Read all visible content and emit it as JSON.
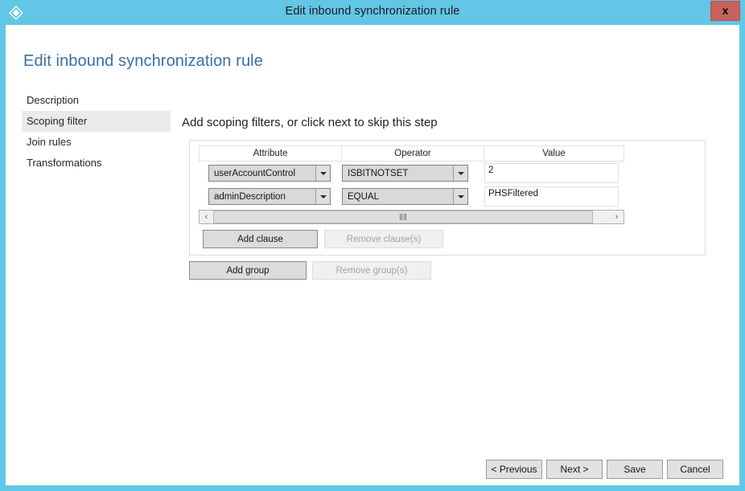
{
  "window": {
    "title": "Edit inbound synchronization rule",
    "icon": "azure-diamond-icon",
    "close_label": "x",
    "titlebar_color": "#62c6e6",
    "close_button_color": "#c7625f"
  },
  "page": {
    "title": "Edit inbound synchronization rule",
    "title_color": "#3a6ea5"
  },
  "sidebar": {
    "items": [
      {
        "label": "Description",
        "selected": false
      },
      {
        "label": "Scoping filter",
        "selected": true
      },
      {
        "label": "Join rules",
        "selected": false
      },
      {
        "label": "Transformations",
        "selected": false
      }
    ]
  },
  "main": {
    "step_heading": "Add scoping filters, or click next to skip this step",
    "table": {
      "columns": [
        "Attribute",
        "Operator",
        "Value"
      ],
      "rows": [
        {
          "attribute": "userAccountControl",
          "operator": "ISBITNOTSET",
          "value": "2"
        },
        {
          "attribute": "adminDescription",
          "operator": "EQUAL",
          "value": "PHSFiltered"
        }
      ]
    },
    "scrollbar": {
      "left_arrow": "‹",
      "right_arrow": "›",
      "grip": "III"
    },
    "clause_buttons": {
      "add_clause": "Add clause",
      "remove_clause": "Remove clause(s)",
      "remove_clause_enabled": false
    },
    "group_buttons": {
      "add_group": "Add group",
      "remove_group": "Remove group(s)",
      "remove_group_enabled": false
    }
  },
  "footer": {
    "previous": "< Previous",
    "next": "Next >",
    "save": "Save",
    "cancel": "Cancel"
  }
}
